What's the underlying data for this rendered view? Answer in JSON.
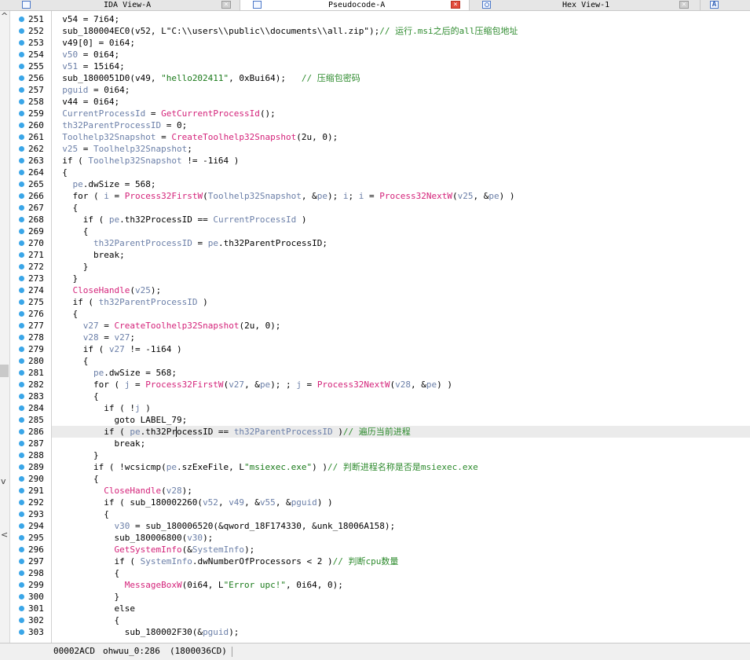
{
  "tabs": [
    {
      "label": "IDA View-A",
      "icon": "disassembly-icon",
      "close": "×"
    },
    {
      "label": "Pseudocode-A",
      "icon": "pseudocode-icon",
      "close": "×"
    },
    {
      "label": "Hex View-1",
      "icon": "hex-view-icon",
      "close": "×"
    },
    {
      "label": "",
      "icon": "structures-icon",
      "icon_text": "A"
    }
  ],
  "left_strip": {
    "up": "^",
    "down": "v",
    "back": "<"
  },
  "code_lines": [
    {
      "n": "251",
      "segs": [
        {
          "t": "  v54 = 7i64;"
        }
      ]
    },
    {
      "n": "252",
      "segs": [
        {
          "t": "  sub_180004EC0(v52, L\"C:\\\\users\\\\public\\\\documents\\\\all.zip\");"
        },
        {
          "t": "// 运行.msi之后的all压缩包地址",
          "k": "c"
        }
      ]
    },
    {
      "n": "253",
      "segs": [
        {
          "t": "  v49[0] = 0i64;"
        }
      ]
    },
    {
      "n": "254",
      "segs": [
        {
          "t": "  "
        },
        {
          "t": "v50",
          "k": "v"
        },
        {
          "t": " = 0i64;"
        }
      ]
    },
    {
      "n": "255",
      "segs": [
        {
          "t": "  "
        },
        {
          "t": "v51",
          "k": "v"
        },
        {
          "t": " = 15i64;"
        }
      ]
    },
    {
      "n": "256",
      "segs": [
        {
          "t": "  sub_1800051D0(v49, "
        },
        {
          "t": "\"hello202411\"",
          "k": "s"
        },
        {
          "t": ", 0xBui64);   "
        },
        {
          "t": "// 压缩包密码",
          "k": "c"
        }
      ]
    },
    {
      "n": "257",
      "segs": [
        {
          "t": "  "
        },
        {
          "t": "pguid",
          "k": "v"
        },
        {
          "t": " = 0i64;"
        }
      ]
    },
    {
      "n": "258",
      "segs": [
        {
          "t": "  v44 = 0i64;"
        }
      ]
    },
    {
      "n": "259",
      "segs": [
        {
          "t": "  "
        },
        {
          "t": "CurrentProcessId",
          "k": "v"
        },
        {
          "t": " = "
        },
        {
          "t": "GetCurrentProcessId",
          "k": "f"
        },
        {
          "t": "();"
        }
      ]
    },
    {
      "n": "260",
      "segs": [
        {
          "t": "  "
        },
        {
          "t": "th32ParentProcessID",
          "k": "v"
        },
        {
          "t": " = 0;"
        }
      ]
    },
    {
      "n": "261",
      "segs": [
        {
          "t": "  "
        },
        {
          "t": "Toolhelp32Snapshot",
          "k": "v"
        },
        {
          "t": " = "
        },
        {
          "t": "CreateToolhelp32Snapshot",
          "k": "f"
        },
        {
          "t": "(2u, 0);"
        }
      ]
    },
    {
      "n": "262",
      "segs": [
        {
          "t": "  "
        },
        {
          "t": "v25",
          "k": "v"
        },
        {
          "t": " = "
        },
        {
          "t": "Toolhelp32Snapshot",
          "k": "v"
        },
        {
          "t": ";"
        }
      ]
    },
    {
      "n": "263",
      "segs": [
        {
          "t": "  if ( "
        },
        {
          "t": "Toolhelp32Snapshot",
          "k": "v"
        },
        {
          "t": " != -1i64 )"
        }
      ]
    },
    {
      "n": "264",
      "segs": [
        {
          "t": "  {"
        }
      ]
    },
    {
      "n": "265",
      "segs": [
        {
          "t": "    "
        },
        {
          "t": "pe",
          "k": "v"
        },
        {
          "t": ".dwSize = 568;"
        }
      ]
    },
    {
      "n": "266",
      "segs": [
        {
          "t": "    for ( "
        },
        {
          "t": "i",
          "k": "v"
        },
        {
          "t": " = "
        },
        {
          "t": "Process32FirstW",
          "k": "f"
        },
        {
          "t": "("
        },
        {
          "t": "Toolhelp32Snapshot",
          "k": "v"
        },
        {
          "t": ", &"
        },
        {
          "t": "pe",
          "k": "v"
        },
        {
          "t": "); "
        },
        {
          "t": "i",
          "k": "v"
        },
        {
          "t": "; "
        },
        {
          "t": "i",
          "k": "v"
        },
        {
          "t": " = "
        },
        {
          "t": "Process32NextW",
          "k": "f"
        },
        {
          "t": "("
        },
        {
          "t": "v25",
          "k": "v"
        },
        {
          "t": ", &"
        },
        {
          "t": "pe",
          "k": "v"
        },
        {
          "t": ") )"
        }
      ]
    },
    {
      "n": "267",
      "segs": [
        {
          "t": "    {"
        }
      ]
    },
    {
      "n": "268",
      "segs": [
        {
          "t": "      if ( "
        },
        {
          "t": "pe",
          "k": "v"
        },
        {
          "t": ".th32ProcessID == "
        },
        {
          "t": "CurrentProcessId",
          "k": "v"
        },
        {
          "t": " )"
        }
      ]
    },
    {
      "n": "269",
      "segs": [
        {
          "t": "      {"
        }
      ]
    },
    {
      "n": "270",
      "segs": [
        {
          "t": "        "
        },
        {
          "t": "th32ParentProcessID",
          "k": "v"
        },
        {
          "t": " = "
        },
        {
          "t": "pe",
          "k": "v"
        },
        {
          "t": ".th32ParentProcessID;"
        }
      ]
    },
    {
      "n": "271",
      "segs": [
        {
          "t": "        break;"
        }
      ]
    },
    {
      "n": "272",
      "segs": [
        {
          "t": "      }"
        }
      ]
    },
    {
      "n": "273",
      "segs": [
        {
          "t": "    }"
        }
      ]
    },
    {
      "n": "274",
      "segs": [
        {
          "t": "    "
        },
        {
          "t": "CloseHandle",
          "k": "f"
        },
        {
          "t": "("
        },
        {
          "t": "v25",
          "k": "v"
        },
        {
          "t": ");"
        }
      ]
    },
    {
      "n": "275",
      "segs": [
        {
          "t": "    if ( "
        },
        {
          "t": "th32ParentProcessID",
          "k": "v"
        },
        {
          "t": " )"
        }
      ]
    },
    {
      "n": "276",
      "segs": [
        {
          "t": "    {"
        }
      ]
    },
    {
      "n": "277",
      "segs": [
        {
          "t": "      "
        },
        {
          "t": "v27",
          "k": "v"
        },
        {
          "t": " = "
        },
        {
          "t": "CreateToolhelp32Snapshot",
          "k": "f"
        },
        {
          "t": "(2u, 0);"
        }
      ]
    },
    {
      "n": "278",
      "segs": [
        {
          "t": "      "
        },
        {
          "t": "v28",
          "k": "v"
        },
        {
          "t": " = "
        },
        {
          "t": "v27",
          "k": "v"
        },
        {
          "t": ";"
        }
      ]
    },
    {
      "n": "279",
      "segs": [
        {
          "t": "      if ( "
        },
        {
          "t": "v27",
          "k": "v"
        },
        {
          "t": " != -1i64 )"
        }
      ]
    },
    {
      "n": "280",
      "segs": [
        {
          "t": "      {"
        }
      ]
    },
    {
      "n": "281",
      "segs": [
        {
          "t": "        "
        },
        {
          "t": "pe",
          "k": "v"
        },
        {
          "t": ".dwSize = 568;"
        }
      ]
    },
    {
      "n": "282",
      "segs": [
        {
          "t": "        for ( "
        },
        {
          "t": "j",
          "k": "v"
        },
        {
          "t": " = "
        },
        {
          "t": "Process32FirstW",
          "k": "f"
        },
        {
          "t": "("
        },
        {
          "t": "v27",
          "k": "v"
        },
        {
          "t": ", &"
        },
        {
          "t": "pe",
          "k": "v"
        },
        {
          "t": "); ; "
        },
        {
          "t": "j",
          "k": "v"
        },
        {
          "t": " = "
        },
        {
          "t": "Process32NextW",
          "k": "f"
        },
        {
          "t": "("
        },
        {
          "t": "v28",
          "k": "v"
        },
        {
          "t": ", &"
        },
        {
          "t": "pe",
          "k": "v"
        },
        {
          "t": ") )"
        }
      ]
    },
    {
      "n": "283",
      "segs": [
        {
          "t": "        {"
        }
      ]
    },
    {
      "n": "284",
      "segs": [
        {
          "t": "          if ( !"
        },
        {
          "t": "j",
          "k": "v"
        },
        {
          "t": " )"
        }
      ]
    },
    {
      "n": "285",
      "segs": [
        {
          "t": "            goto LABEL_79;"
        }
      ]
    },
    {
      "n": "286",
      "current": true,
      "segs": [
        {
          "t": "          if ( "
        },
        {
          "t": "pe",
          "k": "v"
        },
        {
          "t": ".th32Pr"
        },
        {
          "t": "ocessID == ",
          "k": "caret"
        },
        {
          "t": "th32ParentProcessID",
          "k": "v"
        },
        {
          "t": " )"
        },
        {
          "t": "// 遍历当前进程",
          "k": "c"
        }
      ]
    },
    {
      "n": "287",
      "segs": [
        {
          "t": "            break;"
        }
      ]
    },
    {
      "n": "288",
      "segs": [
        {
          "t": "        }"
        }
      ]
    },
    {
      "n": "289",
      "segs": [
        {
          "t": "        if ( !wcsicmp("
        },
        {
          "t": "pe",
          "k": "v"
        },
        {
          "t": ".szExeFile, L"
        },
        {
          "t": "\"msiexec.exe\"",
          "k": "s"
        },
        {
          "t": ") )"
        },
        {
          "t": "// 判断进程名称是否是msiexec.exe",
          "k": "c"
        }
      ]
    },
    {
      "n": "290",
      "segs": [
        {
          "t": "        {"
        }
      ]
    },
    {
      "n": "291",
      "segs": [
        {
          "t": "          "
        },
        {
          "t": "CloseHandle",
          "k": "f"
        },
        {
          "t": "("
        },
        {
          "t": "v28",
          "k": "v"
        },
        {
          "t": ");"
        }
      ]
    },
    {
      "n": "292",
      "segs": [
        {
          "t": "          if ( sub_180002260("
        },
        {
          "t": "v52",
          "k": "v"
        },
        {
          "t": ", "
        },
        {
          "t": "v49",
          "k": "v"
        },
        {
          "t": ", &"
        },
        {
          "t": "v55",
          "k": "v"
        },
        {
          "t": ", &"
        },
        {
          "t": "pguid",
          "k": "v"
        },
        {
          "t": ") )"
        }
      ]
    },
    {
      "n": "293",
      "segs": [
        {
          "t": "          {"
        }
      ]
    },
    {
      "n": "294",
      "segs": [
        {
          "t": "            "
        },
        {
          "t": "v30",
          "k": "v"
        },
        {
          "t": " = sub_180006520(&qword_18F174330, &unk_18006A158);"
        }
      ]
    },
    {
      "n": "295",
      "segs": [
        {
          "t": "            sub_180006800("
        },
        {
          "t": "v30",
          "k": "v"
        },
        {
          "t": ");"
        }
      ]
    },
    {
      "n": "296",
      "segs": [
        {
          "t": "            "
        },
        {
          "t": "GetSystemInfo",
          "k": "f"
        },
        {
          "t": "(&"
        },
        {
          "t": "SystemInfo",
          "k": "v"
        },
        {
          "t": ");"
        }
      ]
    },
    {
      "n": "297",
      "segs": [
        {
          "t": "            if ( "
        },
        {
          "t": "SystemInfo",
          "k": "v"
        },
        {
          "t": ".dwNumberOfProcessors < 2 )"
        },
        {
          "t": "// 判断cpu数量",
          "k": "c"
        }
      ]
    },
    {
      "n": "298",
      "segs": [
        {
          "t": "            {"
        }
      ]
    },
    {
      "n": "299",
      "segs": [
        {
          "t": "              "
        },
        {
          "t": "MessageBoxW",
          "k": "f"
        },
        {
          "t": "(0i64, L"
        },
        {
          "t": "\"Error upc!\"",
          "k": "s"
        },
        {
          "t": ", 0i64, 0);"
        }
      ]
    },
    {
      "n": "300",
      "segs": [
        {
          "t": "            }"
        }
      ]
    },
    {
      "n": "301",
      "segs": [
        {
          "t": "            else"
        }
      ]
    },
    {
      "n": "302",
      "segs": [
        {
          "t": "            {"
        }
      ]
    },
    {
      "n": "303",
      "segs": [
        {
          "t": "              sub_180002F30(&"
        },
        {
          "t": "pguid",
          "k": "v"
        },
        {
          "t": ");"
        }
      ]
    }
  ],
  "status": {
    "address": "00002ACD",
    "location": "ohwuu_0:286",
    "ea": "(1800036CD)"
  }
}
